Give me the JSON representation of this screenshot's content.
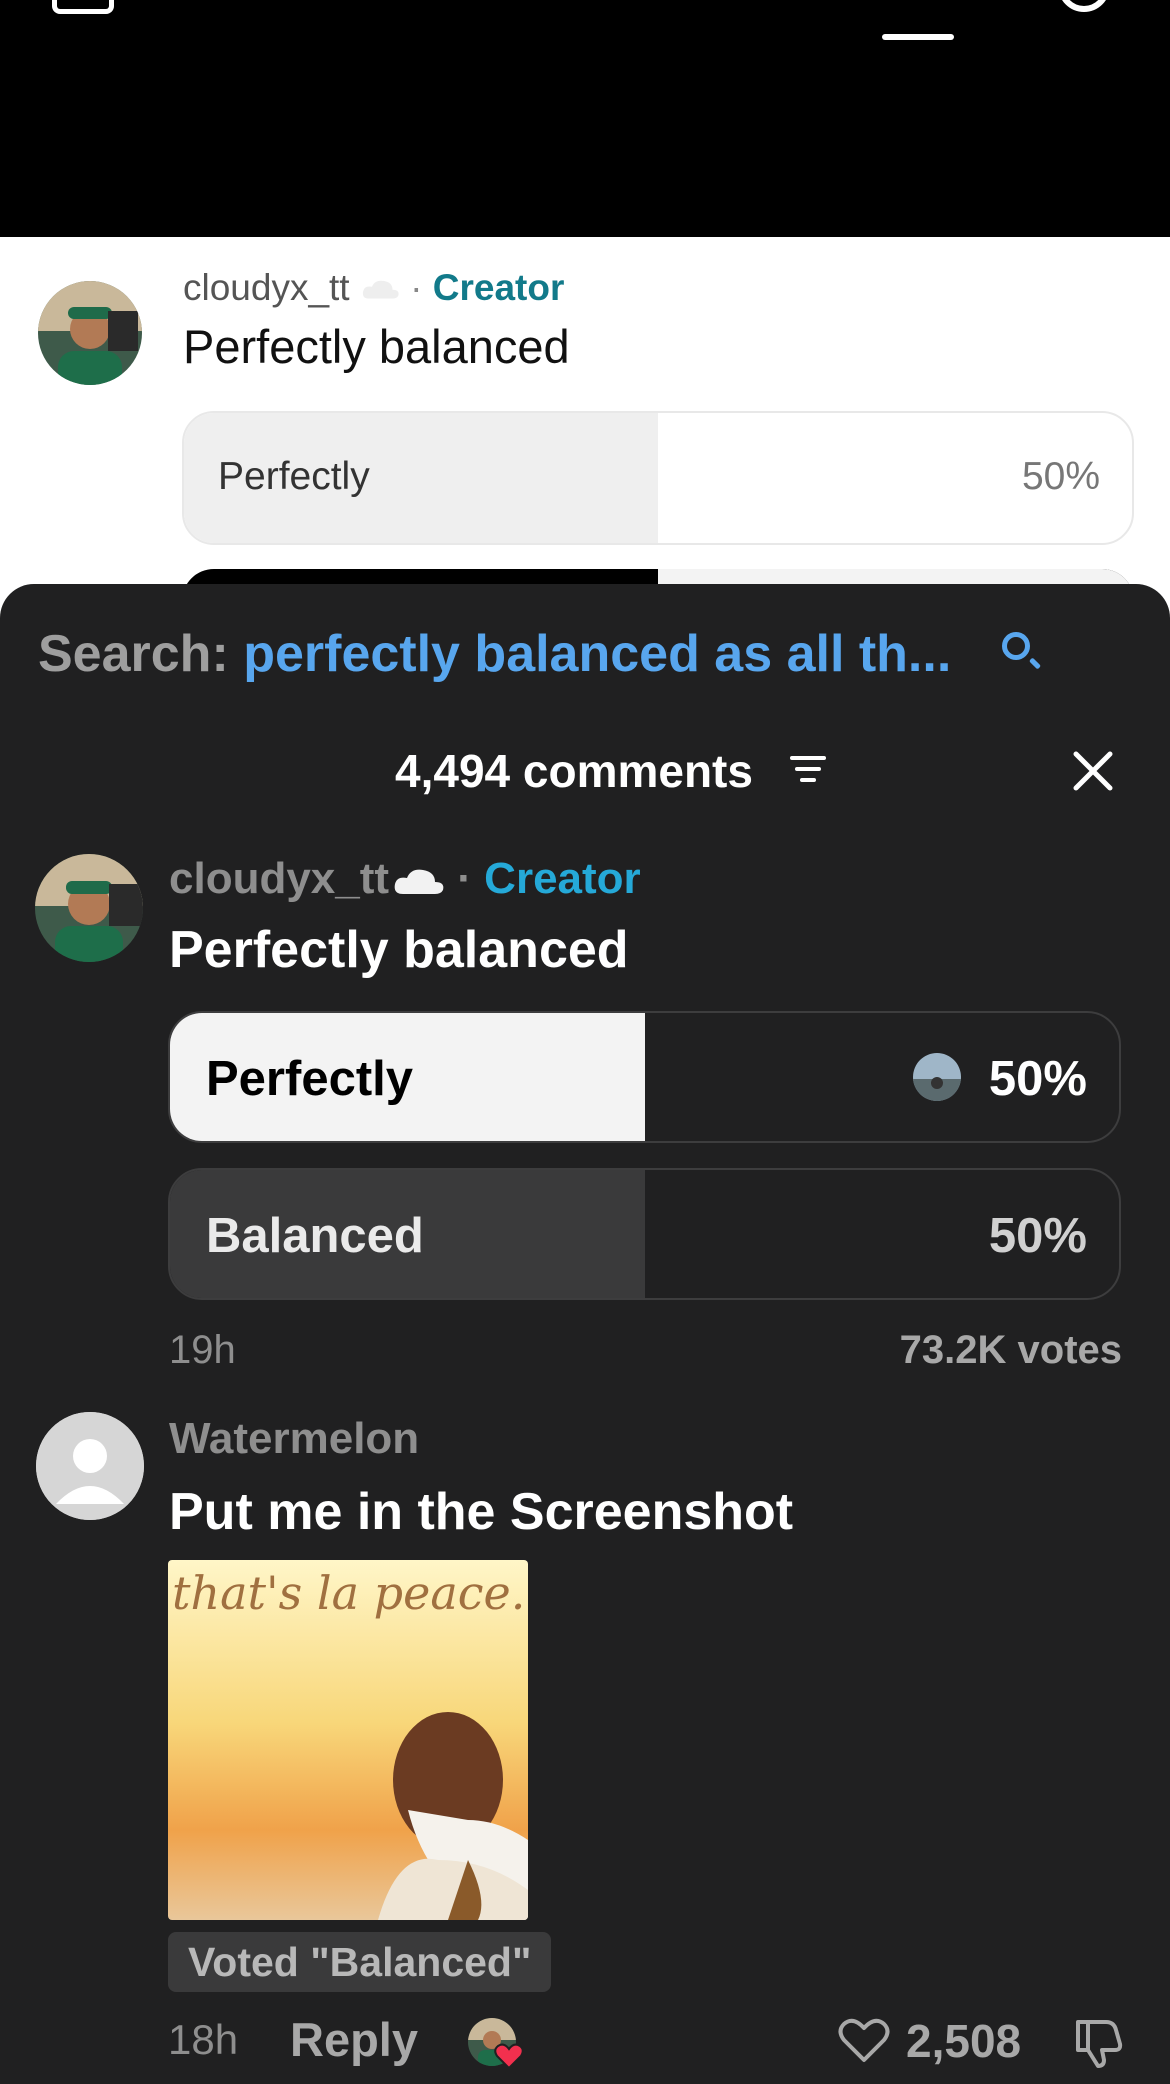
{
  "background_post": {
    "username": "cloudyx_tt",
    "separator": "·",
    "creator_label": "Creator",
    "text": "Perfectly balanced",
    "option1_label": "Perfectly",
    "option1_pct": "50%",
    "option1_fill_fraction": 0.5
  },
  "search": {
    "prefix": "Search: ",
    "query": "perfectly balanced as all th...",
    "icon": "search-icon"
  },
  "comments_header": {
    "count_label": "4,494 comments",
    "sort_icon": "sort-icon",
    "close_icon": "close-icon"
  },
  "creator_comment": {
    "username": "cloudyx_tt",
    "separator": "·",
    "creator_label": "Creator",
    "text": "Perfectly balanced",
    "poll": {
      "options": [
        {
          "label": "Perfectly",
          "pct": "50%",
          "fill_fraction": 0.5,
          "selected": true
        },
        {
          "label": "Balanced",
          "pct": "50%",
          "fill_fraction": 0.5,
          "selected": false
        }
      ],
      "time": "19h",
      "votes": "73.2K votes"
    }
  },
  "reply_comment": {
    "username": "Watermelon",
    "text": "Put me in the Screenshot",
    "image_caption": "that's la peace.",
    "voted_badge": "Voted \"Balanced\"",
    "time": "18h",
    "reply_label": "Reply",
    "like_count": "2,508"
  },
  "colors": {
    "sheet_bg": "#202021",
    "creator_accent": "#25a9d8",
    "search_accent": "#58a6ee"
  }
}
